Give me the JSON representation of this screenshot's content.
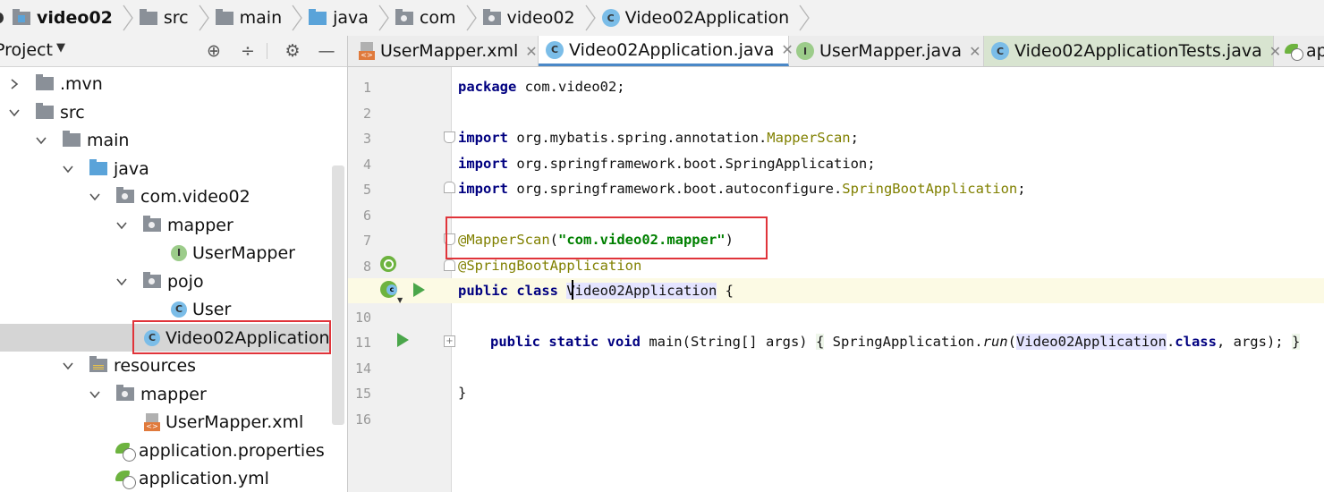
{
  "breadcrumb": [
    {
      "label": "video02",
      "bold": true,
      "icon": "module-folder-icon"
    },
    {
      "label": "src",
      "icon": "folder-icon"
    },
    {
      "label": "main",
      "icon": "folder-icon"
    },
    {
      "label": "java",
      "icon": "source-folder-icon"
    },
    {
      "label": "com",
      "icon": "package-icon"
    },
    {
      "label": "video02",
      "icon": "package-icon"
    },
    {
      "label": "Video02Application",
      "icon": "spring-class-icon"
    }
  ],
  "project_panel": {
    "title": "Project",
    "tree": [
      {
        "label": ".mvn",
        "icon": "folder-icon",
        "expanded": false
      },
      {
        "label": "src",
        "icon": "folder-icon",
        "expanded": true
      },
      {
        "label": "main",
        "icon": "folder-icon",
        "expanded": true
      },
      {
        "label": "java",
        "icon": "source-folder-icon",
        "expanded": true
      },
      {
        "label": "com.video02",
        "icon": "package-icon",
        "expanded": true
      },
      {
        "label": "mapper",
        "icon": "package-icon",
        "expanded": true
      },
      {
        "label": "UserMapper",
        "icon": "interface-icon"
      },
      {
        "label": "pojo",
        "icon": "package-icon",
        "expanded": true
      },
      {
        "label": "User",
        "icon": "class-icon"
      },
      {
        "label": "Video02Application",
        "icon": "spring-class-icon",
        "selected": true
      },
      {
        "label": "resources",
        "icon": "resources-folder-icon",
        "expanded": true
      },
      {
        "label": "mapper",
        "icon": "folder-icon",
        "expanded": true
      },
      {
        "label": "UserMapper.xml",
        "icon": "xml-file-icon"
      },
      {
        "label": "application.properties",
        "icon": "spring-config-icon"
      },
      {
        "label": "application.yml",
        "icon": "spring-config-icon"
      }
    ]
  },
  "tabs": [
    {
      "label": "UserMapper.xml",
      "icon": "xml-file-icon"
    },
    {
      "label": "Video02Application.java",
      "icon": "spring-class-icon",
      "active": true
    },
    {
      "label": "UserMapper.java",
      "icon": "interface-icon"
    },
    {
      "label": "Video02ApplicationTests.java",
      "icon": "test-class-icon"
    },
    {
      "label": "ap",
      "icon": "spring-config-icon"
    }
  ],
  "editor": {
    "line_numbers": [
      "1",
      "2",
      "3",
      "4",
      "5",
      "6",
      "7",
      "8",
      "9",
      "10",
      "11",
      "14",
      "15",
      "16"
    ],
    "code": {
      "l1_kw": "package",
      "l1_rest": " com.video02;",
      "l3_kw": "import",
      "l3_pkg": " org.mybatis.spring.annotation.",
      "l3_cls": "MapperScan",
      "l3_end": ";",
      "l4_kw": "import",
      "l4_rest": " org.springframework.boot.SpringApplication;",
      "l5_kw": "import",
      "l5_pkg": " org.springframework.boot.autoconfigure.",
      "l5_cls": "SpringBootApplication",
      "l5_end": ";",
      "l7_ann": "@MapperScan",
      "l7_open": "(",
      "l7_str": "\"com.video02.mapper\"",
      "l7_close": ")",
      "l8_ann": "@SpringBootApplication",
      "l9_kw": "public class",
      "l9_sp": " ",
      "l9_cls": "Video02Application",
      "l9_rest": " {",
      "l11_kw": "public static void",
      "l11_main": " main(String[] args) ",
      "l11_ob": "{",
      "l11_sa": " SpringApplication.",
      "l11_run": "run",
      "l11_po": "(",
      "l11_cls": "Video02Application",
      "l11_dot": ".",
      "l11_class": "class",
      "l11_args": ", args); ",
      "l11_cb": "}",
      "l15": "}"
    }
  }
}
